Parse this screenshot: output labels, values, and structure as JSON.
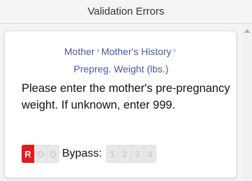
{
  "panel": {
    "title": "Validation Errors"
  },
  "card": {
    "breadcrumb": [
      "Mother",
      "Mother's History",
      "Prepreg. Weight (lbs.)"
    ],
    "breadcrumb_separator": "›",
    "message": "Please enter the mother's pre-pregnancy weight. If unknown, enter 999.",
    "status_buttons": [
      "R",
      "O",
      "Q"
    ],
    "active_status": "R",
    "bypass_label": "Bypass:",
    "bypass_levels": [
      "1",
      "2",
      "3",
      "4"
    ]
  },
  "colors": {
    "accent": "#e21b1b",
    "link": "#4a55a8"
  }
}
